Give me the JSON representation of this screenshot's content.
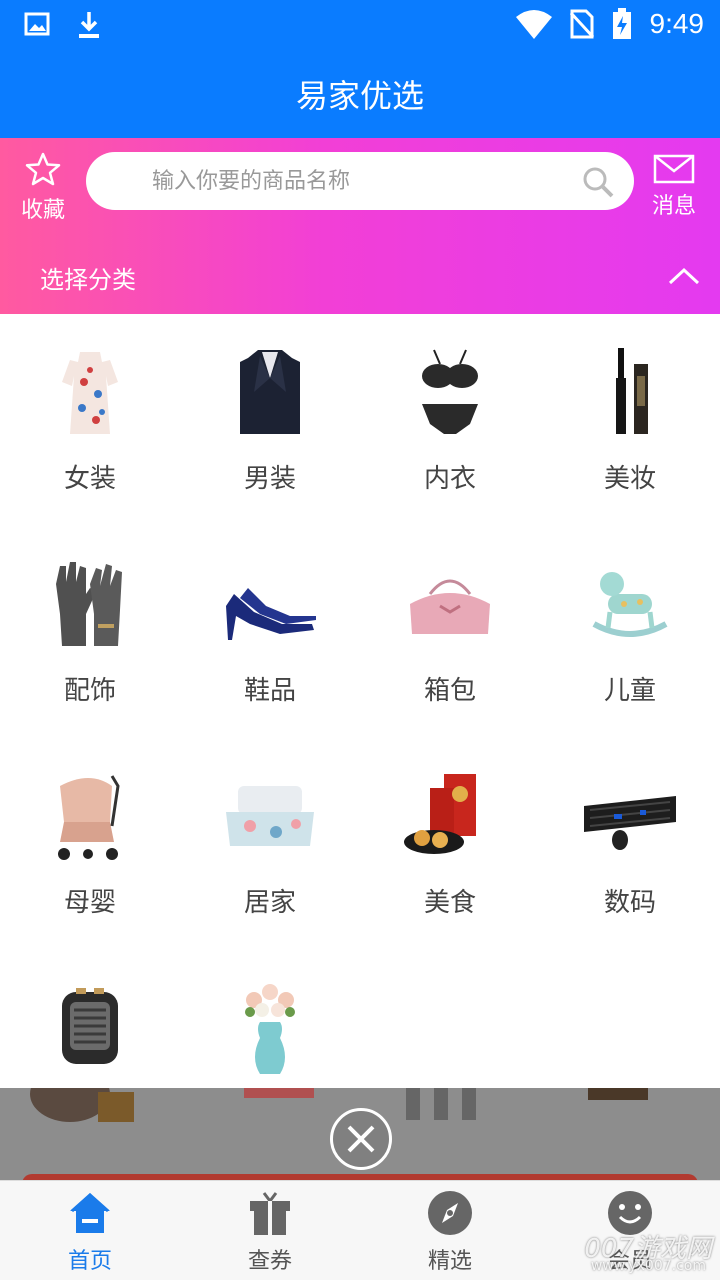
{
  "status_bar": {
    "time": "9:49"
  },
  "app": {
    "title": "易家优选"
  },
  "header": {
    "favorites_label": "收藏",
    "messages_label": "消息",
    "search_placeholder": "输入你要的商品名称",
    "category_toggle_label": "选择分类"
  },
  "categories": [
    {
      "label": "女装",
      "icon": "dress-photo"
    },
    {
      "label": "男装",
      "icon": "suit-photo"
    },
    {
      "label": "内衣",
      "icon": "lingerie-photo"
    },
    {
      "label": "美妆",
      "icon": "mascara-photo"
    },
    {
      "label": "配饰",
      "icon": "gloves-photo"
    },
    {
      "label": "鞋品",
      "icon": "heels-photo"
    },
    {
      "label": "箱包",
      "icon": "handbag-photo"
    },
    {
      "label": "儿童",
      "icon": "rocking-horse-photo"
    },
    {
      "label": "母婴",
      "icon": "stroller-photo"
    },
    {
      "label": "居家",
      "icon": "bedding-photo"
    },
    {
      "label": "美食",
      "icon": "mooncake-photo"
    },
    {
      "label": "数码",
      "icon": "keyboard-photo"
    },
    {
      "label": "",
      "icon": "heater-photo"
    },
    {
      "label": "",
      "icon": "flower-vase-photo"
    }
  ],
  "tabbar": {
    "items": [
      {
        "label": "首页",
        "icon": "home-icon",
        "active": true
      },
      {
        "label": "查券",
        "icon": "gift-icon",
        "active": false
      },
      {
        "label": "精选",
        "icon": "compass-icon",
        "active": false
      },
      {
        "label": "会员",
        "icon": "smiley-icon",
        "active": false
      }
    ]
  },
  "watermark": {
    "text": "007游戏网",
    "url": "www.yx007.com"
  },
  "colors": {
    "primary": "#0a7cff",
    "gradient_start": "#ff5aa0",
    "gradient_end": "#e43af0",
    "tab_active": "#1a7bea"
  }
}
